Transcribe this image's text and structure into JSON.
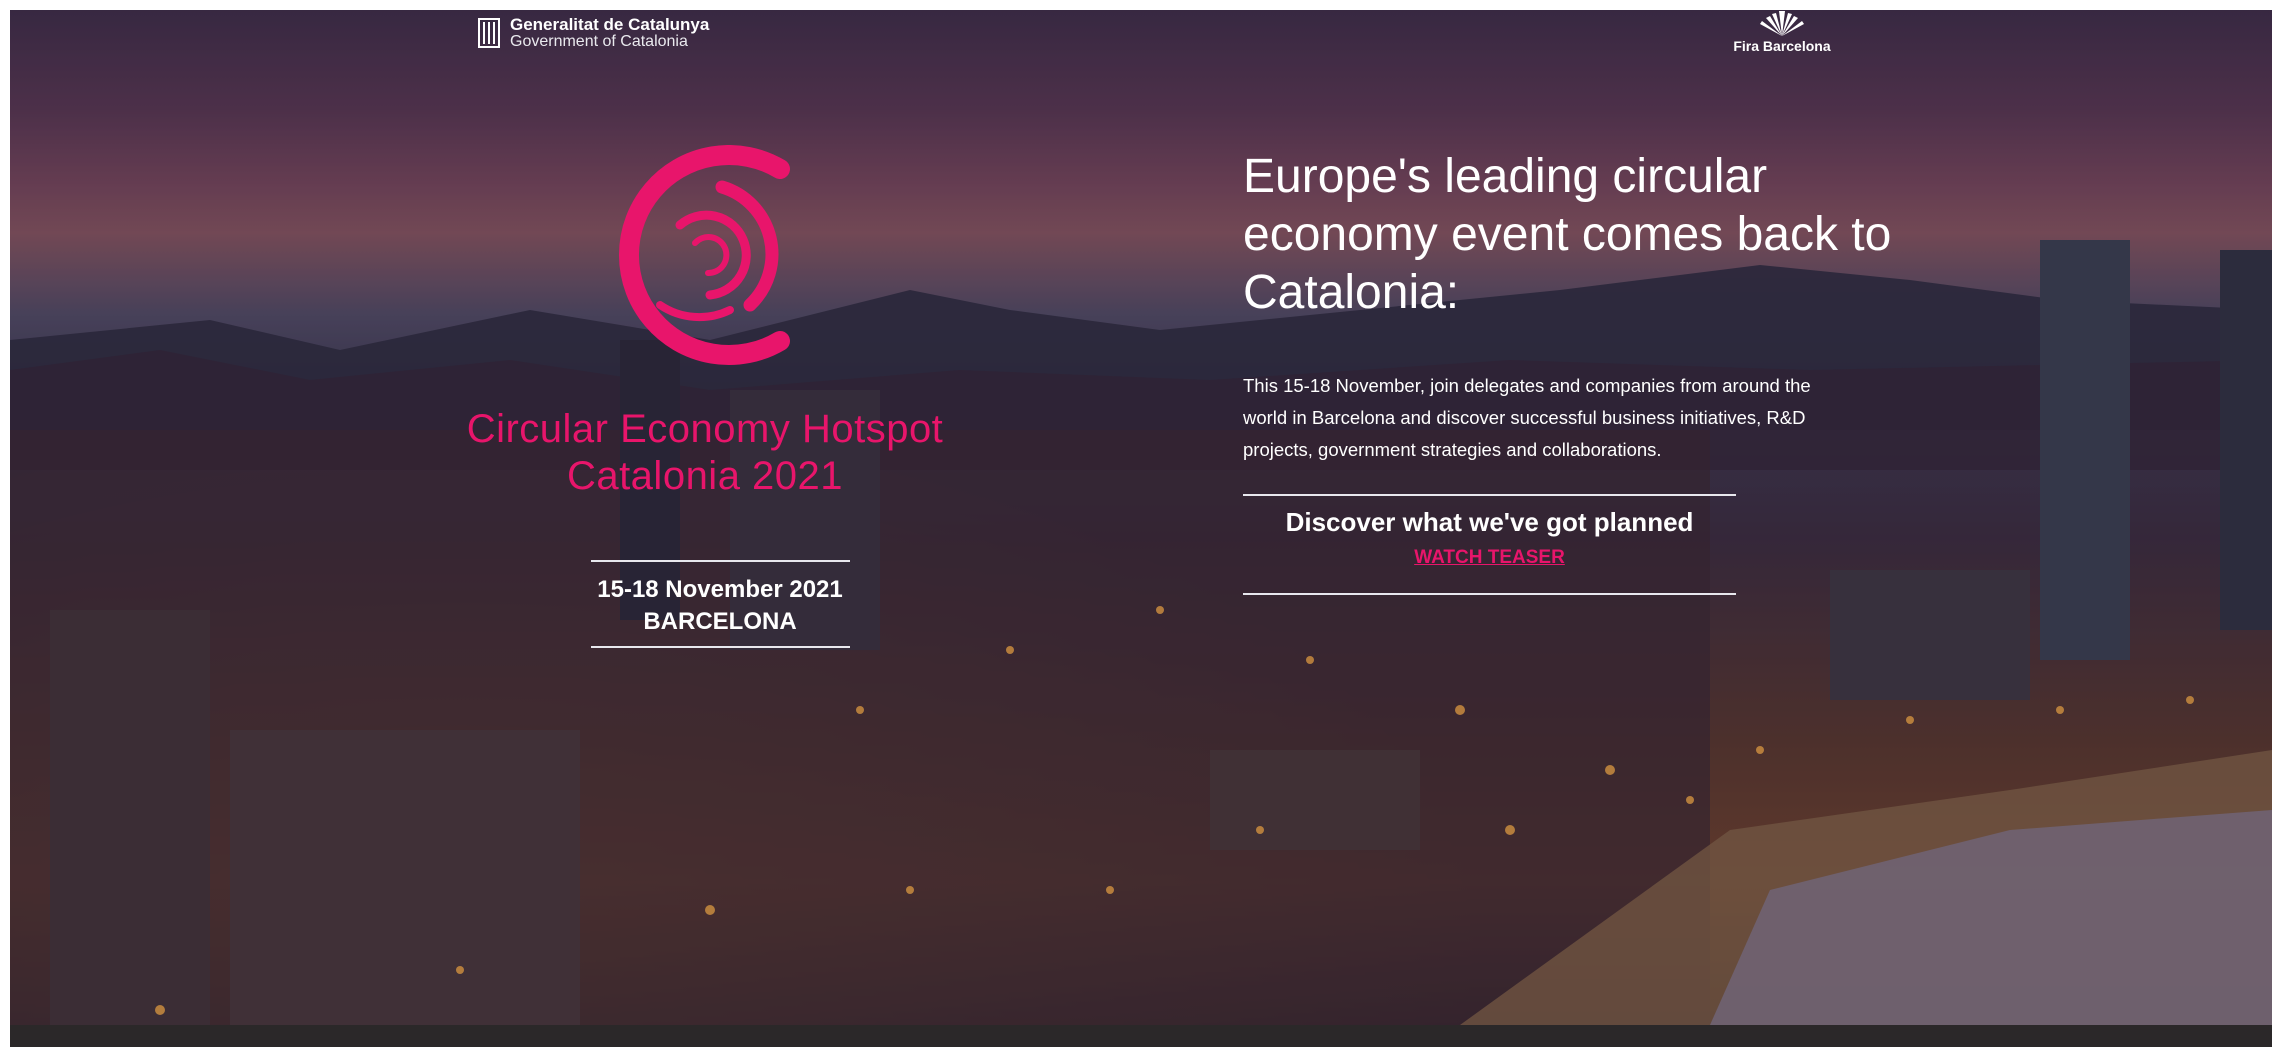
{
  "header": {
    "gov_logo": {
      "name": "Generalitat de Catalunya",
      "subtitle": "Government of Catalonia",
      "icon": "catalonia-flag-icon"
    },
    "fira_logo": {
      "name": "Fira Barcelona",
      "icon": "fira-fan-icon"
    }
  },
  "event": {
    "logo_icon": "circular-economy-logo-icon",
    "title_line1": "Circular Economy Hotspot",
    "title_line2": "Catalonia 2021",
    "dates": "15-18 November 2021",
    "city": "BARCELONA"
  },
  "main": {
    "headline": "Europe's leading circular economy event comes back to Catalonia:",
    "description": "This 15-18 November, join delegates and companies from around the world in Barcelona and discover successful business initiatives, R&D projects, government strategies and collaborations.",
    "discover_title": "Discover what we've got planned",
    "watch_link": "WATCH TEASER"
  },
  "colors": {
    "accent": "#e8156b",
    "text": "#ffffff"
  }
}
